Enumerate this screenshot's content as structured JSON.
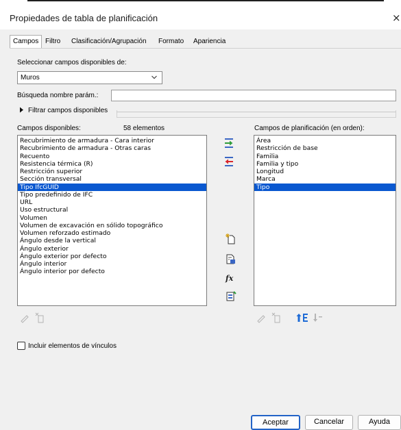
{
  "window": {
    "title": "Propiedades de tabla de planificación",
    "close_glyph": "×"
  },
  "tabs": [
    {
      "label": "Campos",
      "active": true
    },
    {
      "label": "Filtro"
    },
    {
      "label": "Clasificación/Agrupación"
    },
    {
      "label": "Formato"
    },
    {
      "label": "Apariencia"
    }
  ],
  "fields": {
    "select_label": "Seleccionar campos disponibles de:",
    "select_value": "Muros",
    "search_label": "Búsqueda nombre parám.:",
    "search_value": "",
    "filter_label": "Filtrar campos disponibles",
    "available_label": "Campos disponibles:",
    "available_count": "58 elementos",
    "scheduled_label": "Campos de planificación (en orden):",
    "available_items": [
      "Recubrimiento de armadura - Cara interior",
      "Recubrimiento de armadura - Otras caras",
      "Recuento",
      "Resistencia térmica (R)",
      "Restricción superior",
      "Sección transversal",
      "Tipo IfcGUID",
      "Tipo predefinido de IFC",
      "URL",
      "Uso estructural",
      "Volumen",
      "Volumen de excavación en sólido topográfico",
      "Volumen reforzado estimado",
      "Ángulo desde la vertical",
      "Ángulo exterior",
      "Ángulo exterior por defecto",
      "Ángulo interior",
      "Ángulo interior por defecto"
    ],
    "available_selected_index": 6,
    "scheduled_items": [
      "Área",
      "Restricción de base",
      "Familia",
      "Familia y tipo",
      "Longitud",
      "Marca",
      "Tipo"
    ],
    "scheduled_selected_index": 6,
    "include_links_label": "Incluir elementos de vínculos",
    "include_links_checked": false
  },
  "buttons": {
    "ok": "Aceptar",
    "cancel": "Cancelar",
    "help": "Ayuda"
  },
  "colors": {
    "selection": "#0a58d0",
    "add_arrow": "#2e9d3a",
    "remove_arrow": "#d9262c",
    "sort_blue": "#1e6bd6"
  }
}
